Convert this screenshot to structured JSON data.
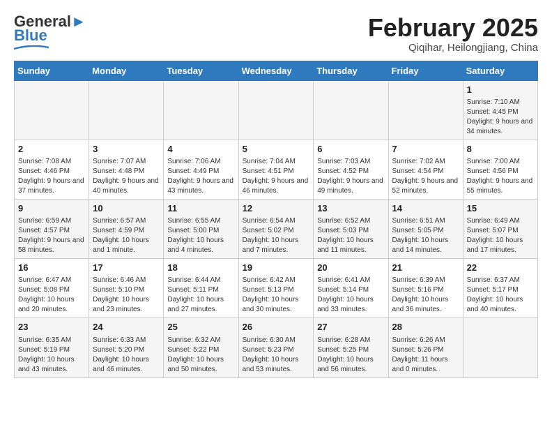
{
  "logo": {
    "line1": "General",
    "line2": "Blue"
  },
  "header": {
    "month": "February 2025",
    "location": "Qiqihar, Heilongjiang, China"
  },
  "weekdays": [
    "Sunday",
    "Monday",
    "Tuesday",
    "Wednesday",
    "Thursday",
    "Friday",
    "Saturday"
  ],
  "weeks": [
    [
      {
        "day": "",
        "info": ""
      },
      {
        "day": "",
        "info": ""
      },
      {
        "day": "",
        "info": ""
      },
      {
        "day": "",
        "info": ""
      },
      {
        "day": "",
        "info": ""
      },
      {
        "day": "",
        "info": ""
      },
      {
        "day": "1",
        "info": "Sunrise: 7:10 AM\nSunset: 4:45 PM\nDaylight: 9 hours and 34 minutes."
      }
    ],
    [
      {
        "day": "2",
        "info": "Sunrise: 7:08 AM\nSunset: 4:46 PM\nDaylight: 9 hours and 37 minutes."
      },
      {
        "day": "3",
        "info": "Sunrise: 7:07 AM\nSunset: 4:48 PM\nDaylight: 9 hours and 40 minutes."
      },
      {
        "day": "4",
        "info": "Sunrise: 7:06 AM\nSunset: 4:49 PM\nDaylight: 9 hours and 43 minutes."
      },
      {
        "day": "5",
        "info": "Sunrise: 7:04 AM\nSunset: 4:51 PM\nDaylight: 9 hours and 46 minutes."
      },
      {
        "day": "6",
        "info": "Sunrise: 7:03 AM\nSunset: 4:52 PM\nDaylight: 9 hours and 49 minutes."
      },
      {
        "day": "7",
        "info": "Sunrise: 7:02 AM\nSunset: 4:54 PM\nDaylight: 9 hours and 52 minutes."
      },
      {
        "day": "8",
        "info": "Sunrise: 7:00 AM\nSunset: 4:56 PM\nDaylight: 9 hours and 55 minutes."
      }
    ],
    [
      {
        "day": "9",
        "info": "Sunrise: 6:59 AM\nSunset: 4:57 PM\nDaylight: 9 hours and 58 minutes."
      },
      {
        "day": "10",
        "info": "Sunrise: 6:57 AM\nSunset: 4:59 PM\nDaylight: 10 hours and 1 minute."
      },
      {
        "day": "11",
        "info": "Sunrise: 6:55 AM\nSunset: 5:00 PM\nDaylight: 10 hours and 4 minutes."
      },
      {
        "day": "12",
        "info": "Sunrise: 6:54 AM\nSunset: 5:02 PM\nDaylight: 10 hours and 7 minutes."
      },
      {
        "day": "13",
        "info": "Sunrise: 6:52 AM\nSunset: 5:03 PM\nDaylight: 10 hours and 11 minutes."
      },
      {
        "day": "14",
        "info": "Sunrise: 6:51 AM\nSunset: 5:05 PM\nDaylight: 10 hours and 14 minutes."
      },
      {
        "day": "15",
        "info": "Sunrise: 6:49 AM\nSunset: 5:07 PM\nDaylight: 10 hours and 17 minutes."
      }
    ],
    [
      {
        "day": "16",
        "info": "Sunrise: 6:47 AM\nSunset: 5:08 PM\nDaylight: 10 hours and 20 minutes."
      },
      {
        "day": "17",
        "info": "Sunrise: 6:46 AM\nSunset: 5:10 PM\nDaylight: 10 hours and 23 minutes."
      },
      {
        "day": "18",
        "info": "Sunrise: 6:44 AM\nSunset: 5:11 PM\nDaylight: 10 hours and 27 minutes."
      },
      {
        "day": "19",
        "info": "Sunrise: 6:42 AM\nSunset: 5:13 PM\nDaylight: 10 hours and 30 minutes."
      },
      {
        "day": "20",
        "info": "Sunrise: 6:41 AM\nSunset: 5:14 PM\nDaylight: 10 hours and 33 minutes."
      },
      {
        "day": "21",
        "info": "Sunrise: 6:39 AM\nSunset: 5:16 PM\nDaylight: 10 hours and 36 minutes."
      },
      {
        "day": "22",
        "info": "Sunrise: 6:37 AM\nSunset: 5:17 PM\nDaylight: 10 hours and 40 minutes."
      }
    ],
    [
      {
        "day": "23",
        "info": "Sunrise: 6:35 AM\nSunset: 5:19 PM\nDaylight: 10 hours and 43 minutes."
      },
      {
        "day": "24",
        "info": "Sunrise: 6:33 AM\nSunset: 5:20 PM\nDaylight: 10 hours and 46 minutes."
      },
      {
        "day": "25",
        "info": "Sunrise: 6:32 AM\nSunset: 5:22 PM\nDaylight: 10 hours and 50 minutes."
      },
      {
        "day": "26",
        "info": "Sunrise: 6:30 AM\nSunset: 5:23 PM\nDaylight: 10 hours and 53 minutes."
      },
      {
        "day": "27",
        "info": "Sunrise: 6:28 AM\nSunset: 5:25 PM\nDaylight: 10 hours and 56 minutes."
      },
      {
        "day": "28",
        "info": "Sunrise: 6:26 AM\nSunset: 5:26 PM\nDaylight: 11 hours and 0 minutes."
      },
      {
        "day": "",
        "info": ""
      }
    ]
  ]
}
